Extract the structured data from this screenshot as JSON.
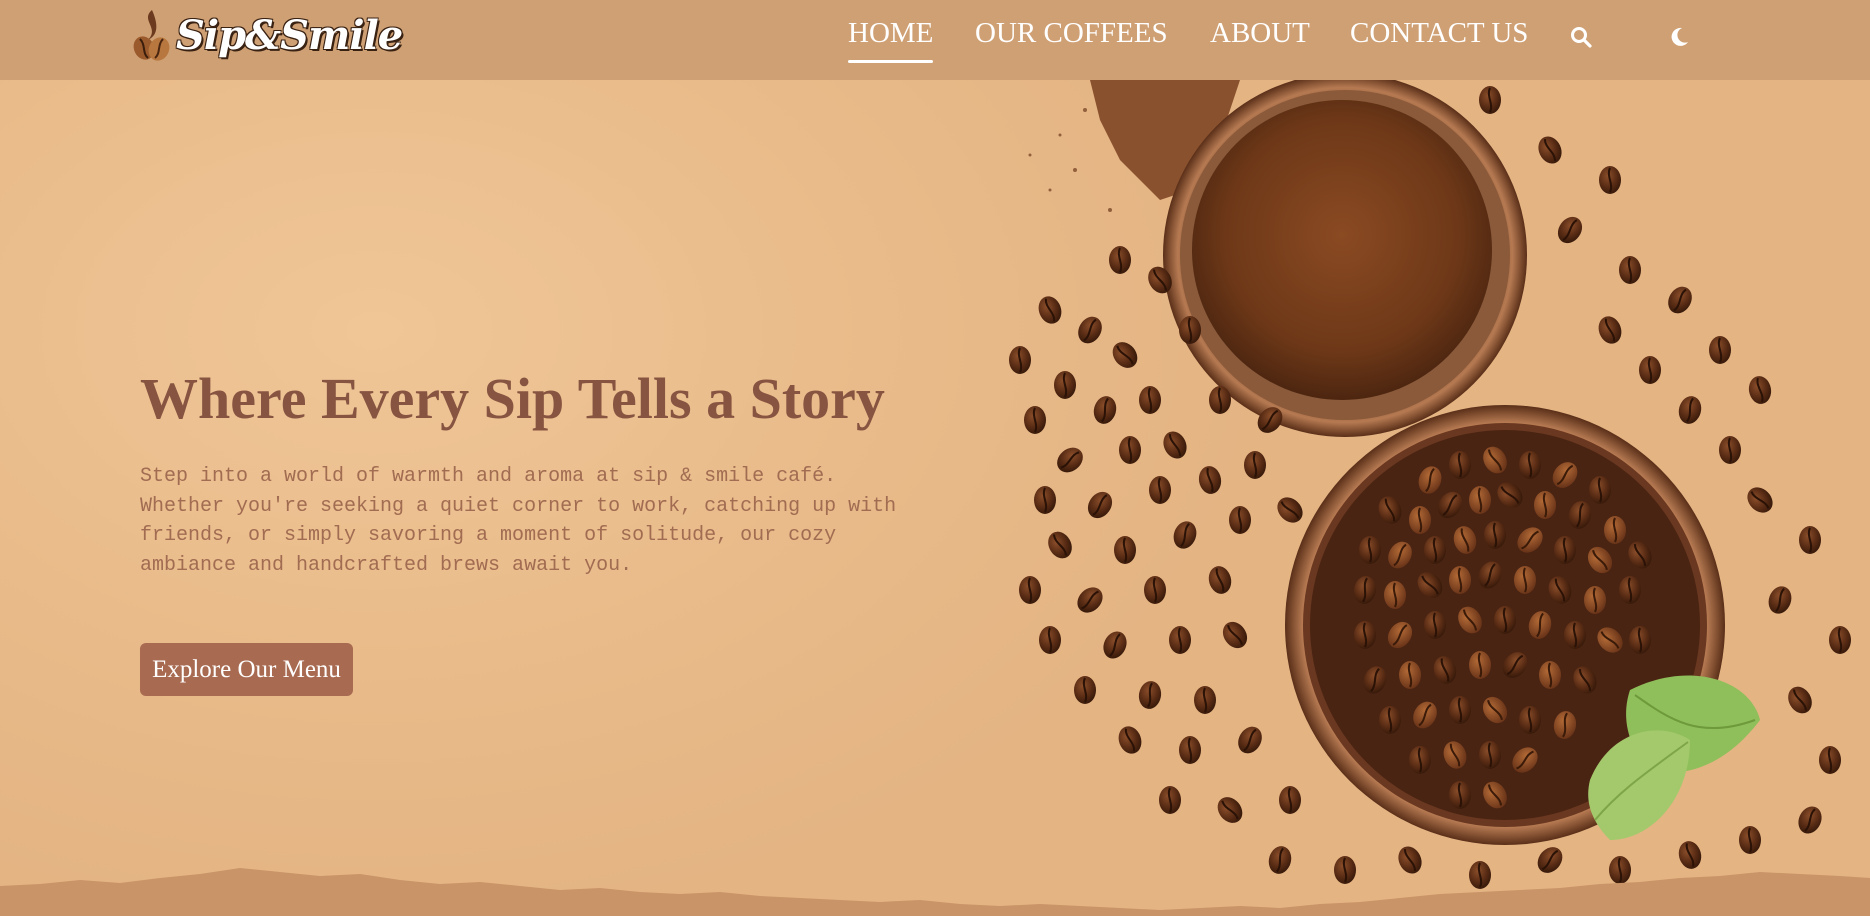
{
  "brand": {
    "name": "Sip&Smile",
    "logo_icon": "coffee-bean-flame-icon"
  },
  "nav": {
    "links": [
      {
        "label": "HOME",
        "active": true
      },
      {
        "label": "OUR COFFEES",
        "active": false
      },
      {
        "label": "ABOUT",
        "active": false
      },
      {
        "label": "CONTACT US",
        "active": false
      }
    ],
    "search_icon": "search-icon",
    "theme_icon": "moon-icon"
  },
  "hero": {
    "title": "Where Every Sip Tells a Story",
    "description": "Step into a world of warmth and aroma at sip & smile café. Whether you're seeking a quiet corner to work, catching up with friends, or simply savoring a moment of solitude, our cozy ambiance and handcrafted brews await you.",
    "button_label": "Explore Our Menu",
    "image_subject": "coffee-beans-and-ground-coffee-bowls"
  },
  "colors": {
    "navbar": "#cfa074",
    "background": "#e9bd8c",
    "title": "#875441",
    "body_text": "#a16c52",
    "button": "#a86a50",
    "nav_text": "#ffffff"
  }
}
